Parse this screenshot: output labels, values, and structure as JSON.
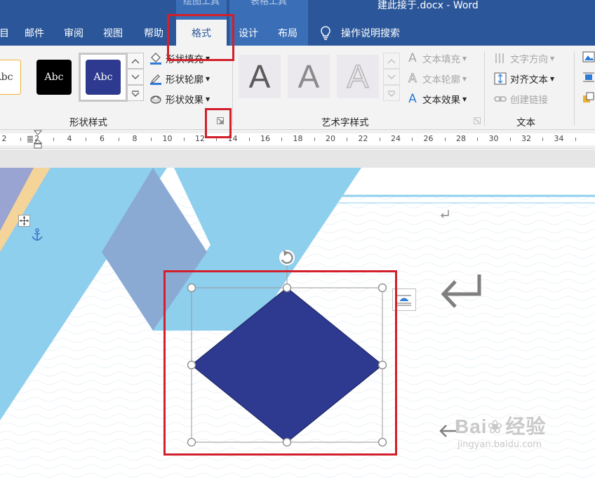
{
  "window": {
    "context_tabs": [
      "绘图工具",
      "表格工具"
    ],
    "title": "建此接于.docx  -  Word"
  },
  "tabs": [
    "目",
    "邮件",
    "审阅",
    "视图",
    "帮助",
    "格式",
    "设计",
    "布局"
  ],
  "active_tab": "格式",
  "tell_me": "操作说明搜索",
  "ribbon": {
    "shape_styles": {
      "swatches": [
        "Abc",
        "Abc",
        "Abc"
      ],
      "fill": "形状填充",
      "outline": "形状轮廓",
      "effects": "形状效果",
      "label": "形状样式"
    },
    "wordart": {
      "letters": [
        "A",
        "A",
        "A"
      ],
      "text_fill": "文本填充",
      "text_outline": "文本轮廓",
      "text_effects": "文本效果",
      "label": "艺术字样式"
    },
    "text": {
      "direction": "文字方向",
      "align": "对齐文本",
      "link": "创建链接",
      "label": "文本"
    }
  },
  "ruler": {
    "labels": [
      "2",
      "2",
      "4",
      "6",
      "8",
      "10",
      "12",
      "14",
      "16",
      "18",
      "20",
      "22",
      "24",
      "26",
      "28",
      "30",
      "32",
      "34"
    ]
  },
  "watermark": {
    "brand": "Bai",
    "brand2": "经验",
    "url": "jingyan.baidu.com"
  },
  "colors": {
    "ribbon_blue": "#2b579a",
    "diamond_fill": "#2e3a8f",
    "highlight_red": "#d21f2a",
    "light_blue": "#8ecfee"
  },
  "icons": {
    "fill": "paint-bucket-icon",
    "outline": "pencil-icon",
    "effects": "shape-effects-icon",
    "rotate": "rotate-icon",
    "paragraph": "paragraph-mark-icon"
  }
}
